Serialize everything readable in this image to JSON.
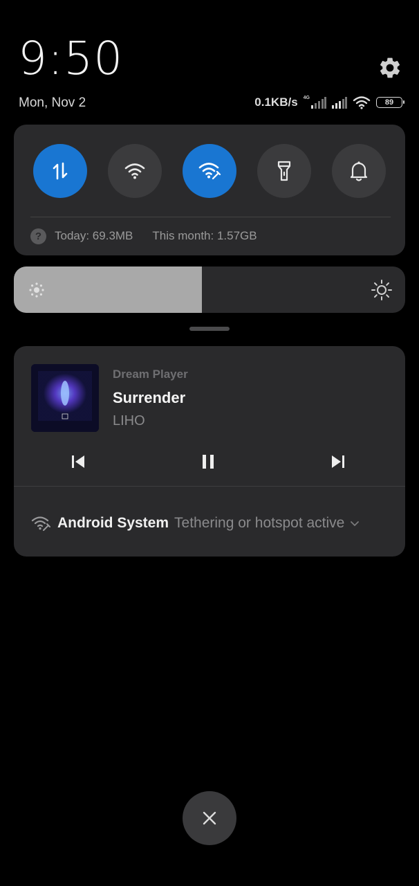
{
  "header": {
    "time": "9:50",
    "date": "Mon, Nov 2"
  },
  "status_bar": {
    "network_speed": "0.1KB/s",
    "network_type": "4G",
    "battery": "89"
  },
  "quick_settings": {
    "tiles": [
      {
        "name": "mobile-data",
        "icon": "data-arrows-icon",
        "active": true
      },
      {
        "name": "wifi",
        "icon": "wifi-icon",
        "active": false
      },
      {
        "name": "hotspot",
        "icon": "hotspot-icon",
        "active": true
      },
      {
        "name": "flashlight",
        "icon": "flashlight-icon",
        "active": false
      },
      {
        "name": "sound",
        "icon": "bell-icon",
        "active": false
      }
    ],
    "usage_today": "Today: 69.3MB",
    "usage_month": "This month: 1.57GB"
  },
  "brightness": {
    "level": 0.48
  },
  "media_notification": {
    "app_name": "Dream Player",
    "title": "Surrender",
    "artist": "LIHO"
  },
  "system_notification": {
    "app": "Android System",
    "text": "Tethering or hotspot active"
  },
  "colors": {
    "accent": "#1976d2",
    "panel": "#2a2a2c",
    "tile_inactive": "#3b3b3d"
  }
}
